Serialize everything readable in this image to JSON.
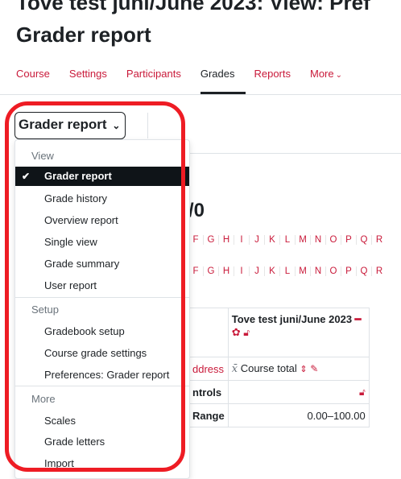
{
  "header": {
    "title_line1": "Tove test juni/June 2023: View: Pref",
    "title_line2": "Grader report"
  },
  "nav": {
    "tabs": [
      "Course",
      "Settings",
      "Participants",
      "Grades",
      "Reports",
      "More"
    ],
    "active": "Grades",
    "more_icon": "chevron-down-icon"
  },
  "report_selector": {
    "label": "Grader report",
    "icon": "chevron-down-icon"
  },
  "menu": {
    "sections": [
      {
        "header": "View",
        "items": [
          "Grader report",
          "Grade history",
          "Overview report",
          "Single view",
          "Grade summary",
          "User report"
        ]
      },
      {
        "header": "Setup",
        "items": [
          "Gradebook setup",
          "Course grade settings",
          "Preferences: Grader report"
        ]
      },
      {
        "header": "More",
        "items": [
          "Scales",
          "Grade letters",
          "Import"
        ]
      }
    ],
    "selected": "Grader report",
    "check_icon": "check-icon"
  },
  "content": {
    "heading_fragment": "/0",
    "letters_row1": [
      "F",
      "G",
      "H",
      "I",
      "J",
      "K",
      "L",
      "M",
      "N",
      "O",
      "P",
      "Q",
      "R"
    ],
    "letters_row2": [
      "F",
      "G",
      "H",
      "I",
      "J",
      "K",
      "L",
      "M",
      "N",
      "O",
      "P",
      "Q",
      "R"
    ],
    "table": {
      "course_header": "Tove test juni/June 2023",
      "email_fragment": "ddress",
      "course_total": "Course total",
      "controls_fragment": "ntrols",
      "range_fragment": "Range",
      "range_value": "0.00–100.00"
    }
  },
  "colors": {
    "link": "#c91a3a",
    "highlight_outline": "#ee1c24",
    "selected_bg": "#0f1418"
  }
}
